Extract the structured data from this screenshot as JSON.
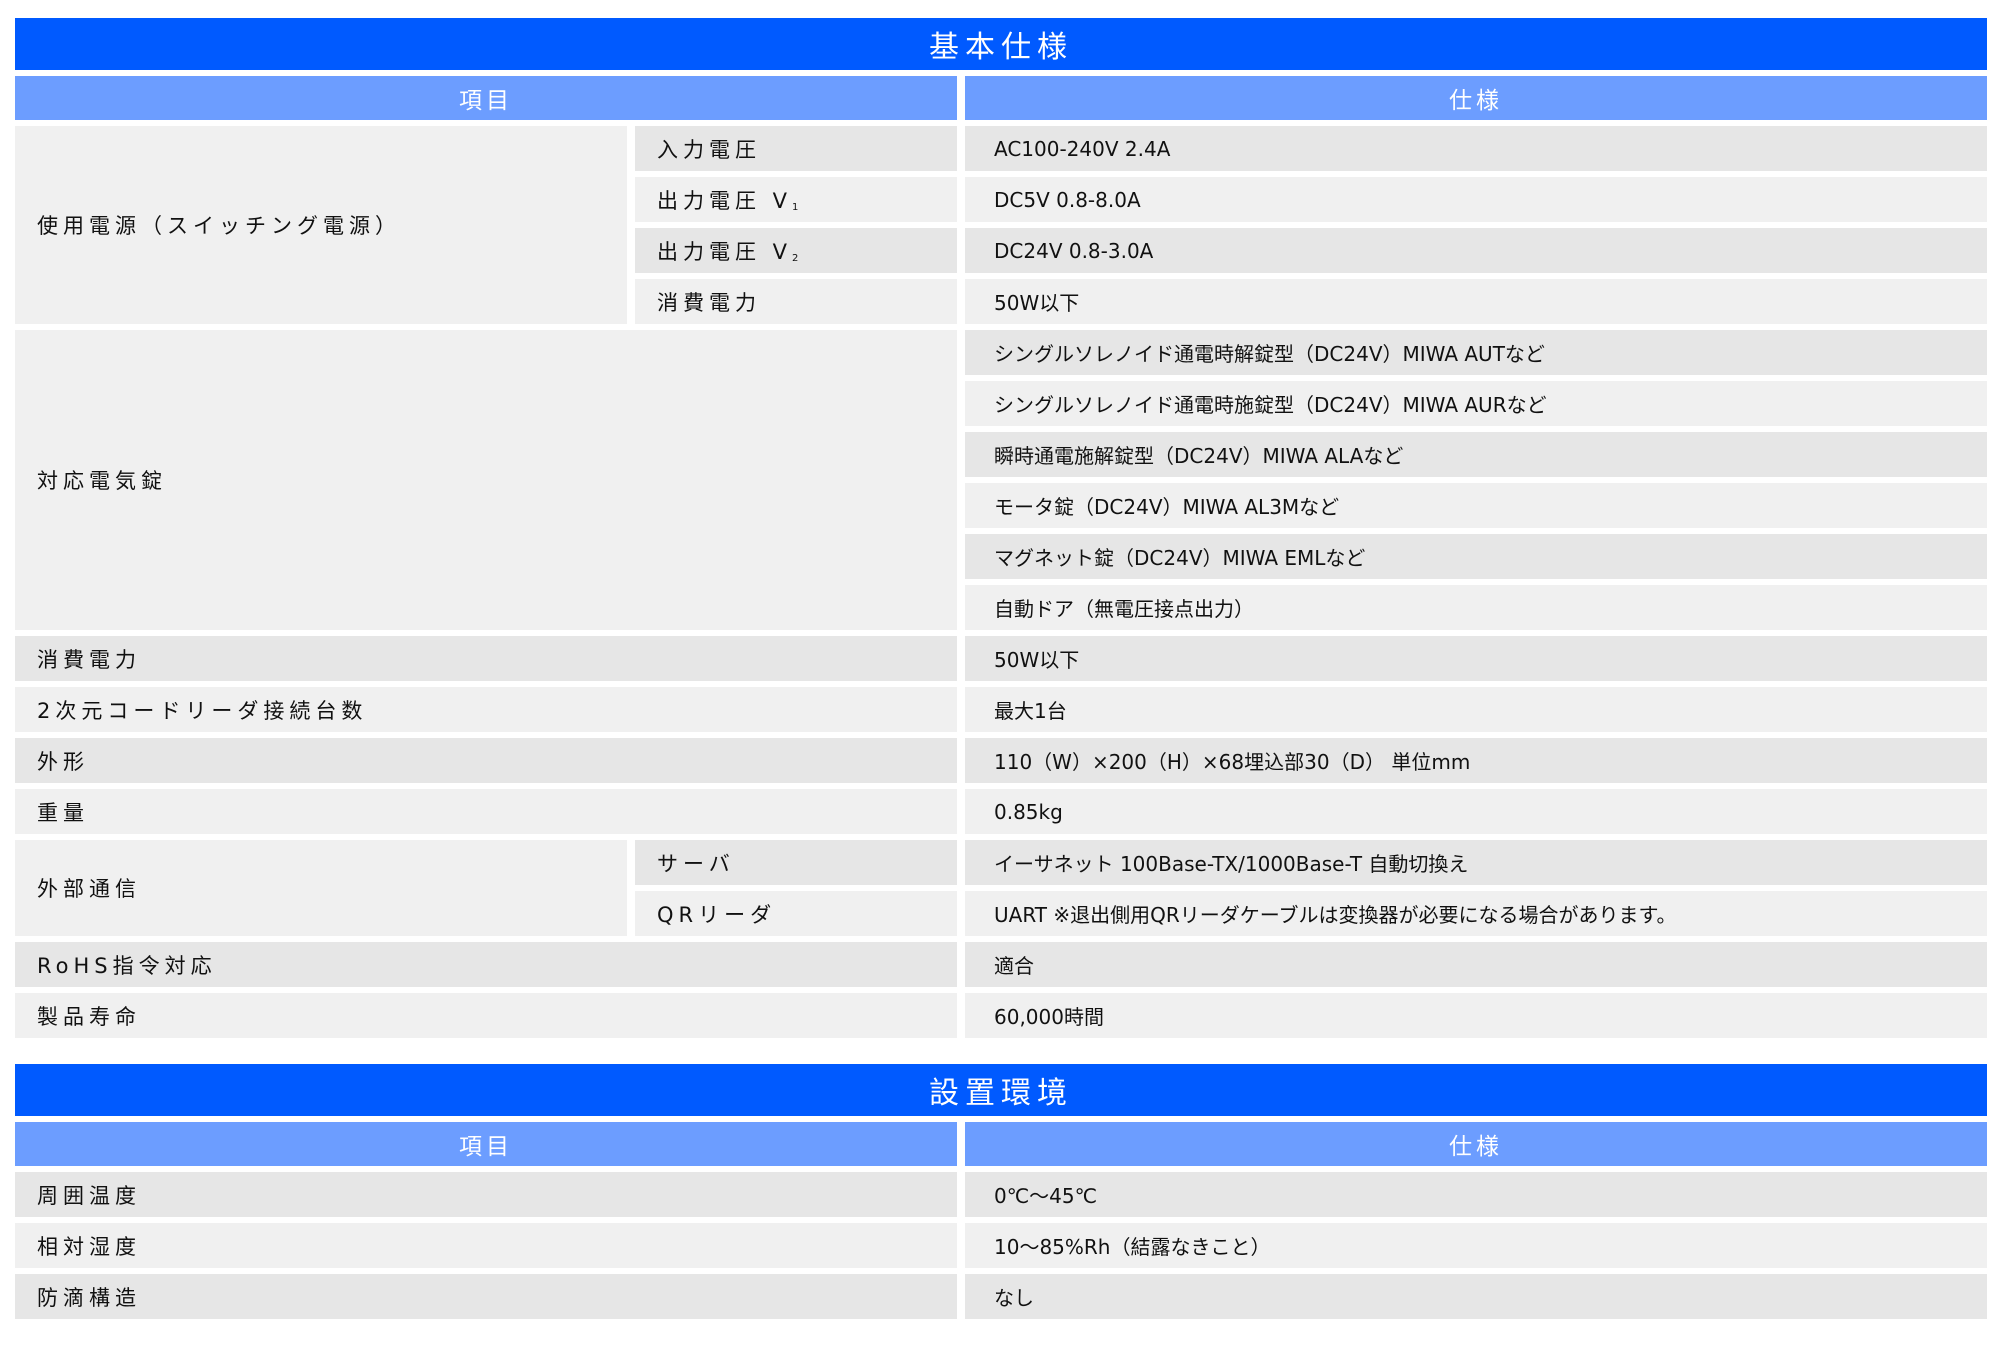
{
  "basic": {
    "title": "基本仕様",
    "head_item": "項目",
    "head_spec": "仕様",
    "power_group": "使用電源（スイッチング電源）",
    "power_rows": [
      {
        "label": "入力電圧",
        "spec": "AC100-240V 2.4A"
      },
      {
        "label": "出力電圧 V",
        "sub": "1",
        "spec": "DC5V 0.8-8.0A"
      },
      {
        "label": "出力電圧 V",
        "sub": "2",
        "spec": "DC24V  0.8-3.0A"
      },
      {
        "label": "消費電力",
        "spec": "50W以下"
      }
    ],
    "lock_group": "対応電気錠",
    "lock_specs": [
      "シングルソレノイド通電時解錠型（DC24V）MIWA AUTなど",
      "シングルソレノイド通電時施錠型（DC24V）MIWA AURなど",
      "瞬時通電施解錠型（DC24V）MIWA  ALAなど",
      "モータ錠（DC24V）MIWA  AL3Mなど",
      "マグネット錠（DC24V）MIWA  EMLなど",
      "自動ドア（無電圧接点出力）"
    ],
    "rows1": [
      {
        "label": "消費電力",
        "spec": "50W以下"
      },
      {
        "label": "2次元コードリーダ接続台数",
        "spec": "最大1台"
      },
      {
        "label": "外形",
        "spec": "110（W）×200（H）×68埋込部30（D） 単位mm"
      },
      {
        "label": "重量",
        "spec": "0.85kg"
      }
    ],
    "comm_group": "外部通信",
    "comm_rows": [
      {
        "label": "サーバ",
        "spec": "イーサネット 100Base-TX/1000Base-T 自動切換え"
      },
      {
        "label": "QRリーダ",
        "spec": "UART ※退出側用QRリーダケーブルは変換器が必要になる場合があります。"
      }
    ],
    "rows2": [
      {
        "label": "RoHS指令対応",
        "spec": "適合"
      },
      {
        "label": "製品寿命",
        "spec": "60,000時間"
      }
    ]
  },
  "env": {
    "title": "設置環境",
    "head_item": "項目",
    "head_spec": "仕様",
    "rows": [
      {
        "label": "周囲温度",
        "spec": "0℃～45℃"
      },
      {
        "label": "相対湿度",
        "spec": "10～85%Rh（結露なきこと）"
      },
      {
        "label": "防滴構造",
        "spec": "なし"
      }
    ]
  },
  "colors": {
    "title_bg": "#005aff",
    "header_bg": "#6c9dff",
    "row_light": "#f0f0f0",
    "row_gray": "#e6e6e6"
  }
}
